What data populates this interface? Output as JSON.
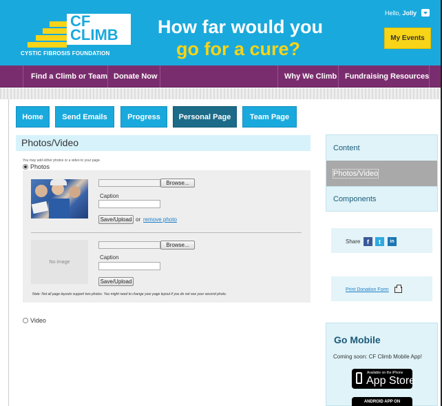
{
  "header": {
    "logo_cf": "CF",
    "logo_climb": "CLIMB",
    "logo_subtitle": "CYSTIC FIBROSIS FOUNDATION",
    "slogan_line1": "How far would you",
    "slogan_line2": "go for a cure?",
    "greeting": "Hello,",
    "user_name": "Jolly",
    "my_events_label": "My Events"
  },
  "nav": {
    "items": [
      {
        "label": "Find a Climb or Team"
      },
      {
        "label": "Donate Now"
      },
      {
        "label": "Why We Climb"
      },
      {
        "label": "Fundraising Resources"
      }
    ]
  },
  "tabs": [
    {
      "label": "Home"
    },
    {
      "label": "Send Emails"
    },
    {
      "label": "Progress"
    },
    {
      "label": "Personal Page",
      "active": true
    },
    {
      "label": "Team Page"
    }
  ],
  "main": {
    "section_title": "Photos/Video",
    "hint": "You may add either photos or a video to your page.",
    "radio_photos": "Photos",
    "radio_video": "Video",
    "selected": "Photos",
    "photo1": {
      "browse_label": "Browse...",
      "caption_label": "Caption",
      "upload_label": "Save/Upload",
      "or_text": "or",
      "remove_label": "remove photo"
    },
    "photo2": {
      "no_image_text": "No image",
      "browse_label": "Browse...",
      "caption_label": "Caption",
      "upload_label": "Save/Upload"
    },
    "note": "Note: Not all page layouts support two photos. You might need to change your page layout if you do not see your second photo."
  },
  "sidebar": {
    "items": [
      {
        "label": "Content"
      },
      {
        "label": "Photos/Video",
        "selected": true
      },
      {
        "label": "Components"
      }
    ],
    "share_label": "Share",
    "social": [
      {
        "icon": "facebook-icon",
        "glyph": "f",
        "color": "#3b5998"
      },
      {
        "icon": "twitter-icon",
        "glyph": "t",
        "color": "#2fa9e0"
      },
      {
        "icon": "linkedin-icon",
        "glyph": "in",
        "color": "#1a75b2"
      }
    ],
    "print_label": "Print Donation Form",
    "mobile_title": "Go Mobile",
    "mobile_subtitle": "Coming soon: CF Climb Mobile App!",
    "appstore_small": "Available on the iPhone",
    "appstore_big": "App Store",
    "android_label": "ANDROID APP ON"
  },
  "colors": {
    "header_blue": "#1aa9dc",
    "nav_purple": "#7a2d6e",
    "accent_yellow": "#f7d417",
    "active_tab": "#1c6b89"
  }
}
